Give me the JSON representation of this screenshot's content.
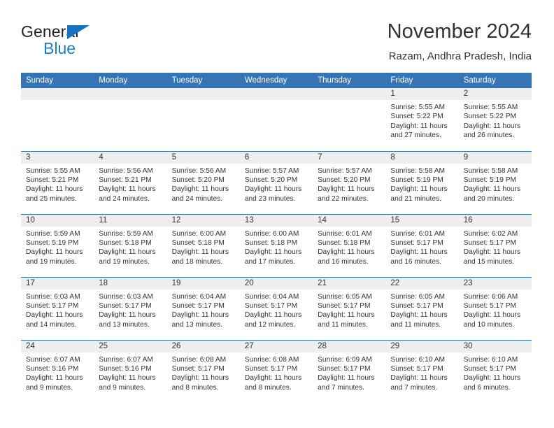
{
  "brand": {
    "word_one": "General",
    "word_two": "Blue",
    "triangle_icon": "blue-triangle-logo-mark",
    "accent_color": "#1a7ec6"
  },
  "header": {
    "title": "November 2024",
    "subtitle": "Razam, Andhra Pradesh, India"
  },
  "theme": {
    "header_blue": "#3575b5",
    "band_gray": "#eeeeee",
    "text": "#333333"
  },
  "weekdays": [
    "Sunday",
    "Monday",
    "Tuesday",
    "Wednesday",
    "Thursday",
    "Friday",
    "Saturday"
  ],
  "labels": {
    "sunrise": "Sunrise:",
    "sunset": "Sunset:",
    "daylight": "Daylight:"
  },
  "weeks": [
    [
      {
        "day": "",
        "sunrise": "",
        "sunset": "",
        "daylight_line1": "",
        "daylight_line2": ""
      },
      {
        "day": "",
        "sunrise": "",
        "sunset": "",
        "daylight_line1": "",
        "daylight_line2": ""
      },
      {
        "day": "",
        "sunrise": "",
        "sunset": "",
        "daylight_line1": "",
        "daylight_line2": ""
      },
      {
        "day": "",
        "sunrise": "",
        "sunset": "",
        "daylight_line1": "",
        "daylight_line2": ""
      },
      {
        "day": "",
        "sunrise": "",
        "sunset": "",
        "daylight_line1": "",
        "daylight_line2": ""
      },
      {
        "day": "1",
        "sunrise": "Sunrise: 5:55 AM",
        "sunset": "Sunset: 5:22 PM",
        "daylight_line1": "Daylight: 11 hours",
        "daylight_line2": "and 27 minutes."
      },
      {
        "day": "2",
        "sunrise": "Sunrise: 5:55 AM",
        "sunset": "Sunset: 5:22 PM",
        "daylight_line1": "Daylight: 11 hours",
        "daylight_line2": "and 26 minutes."
      }
    ],
    [
      {
        "day": "3",
        "sunrise": "Sunrise: 5:55 AM",
        "sunset": "Sunset: 5:21 PM",
        "daylight_line1": "Daylight: 11 hours",
        "daylight_line2": "and 25 minutes."
      },
      {
        "day": "4",
        "sunrise": "Sunrise: 5:56 AM",
        "sunset": "Sunset: 5:21 PM",
        "daylight_line1": "Daylight: 11 hours",
        "daylight_line2": "and 24 minutes."
      },
      {
        "day": "5",
        "sunrise": "Sunrise: 5:56 AM",
        "sunset": "Sunset: 5:20 PM",
        "daylight_line1": "Daylight: 11 hours",
        "daylight_line2": "and 24 minutes."
      },
      {
        "day": "6",
        "sunrise": "Sunrise: 5:57 AM",
        "sunset": "Sunset: 5:20 PM",
        "daylight_line1": "Daylight: 11 hours",
        "daylight_line2": "and 23 minutes."
      },
      {
        "day": "7",
        "sunrise": "Sunrise: 5:57 AM",
        "sunset": "Sunset: 5:20 PM",
        "daylight_line1": "Daylight: 11 hours",
        "daylight_line2": "and 22 minutes."
      },
      {
        "day": "8",
        "sunrise": "Sunrise: 5:58 AM",
        "sunset": "Sunset: 5:19 PM",
        "daylight_line1": "Daylight: 11 hours",
        "daylight_line2": "and 21 minutes."
      },
      {
        "day": "9",
        "sunrise": "Sunrise: 5:58 AM",
        "sunset": "Sunset: 5:19 PM",
        "daylight_line1": "Daylight: 11 hours",
        "daylight_line2": "and 20 minutes."
      }
    ],
    [
      {
        "day": "10",
        "sunrise": "Sunrise: 5:59 AM",
        "sunset": "Sunset: 5:19 PM",
        "daylight_line1": "Daylight: 11 hours",
        "daylight_line2": "and 19 minutes."
      },
      {
        "day": "11",
        "sunrise": "Sunrise: 5:59 AM",
        "sunset": "Sunset: 5:18 PM",
        "daylight_line1": "Daylight: 11 hours",
        "daylight_line2": "and 19 minutes."
      },
      {
        "day": "12",
        "sunrise": "Sunrise: 6:00 AM",
        "sunset": "Sunset: 5:18 PM",
        "daylight_line1": "Daylight: 11 hours",
        "daylight_line2": "and 18 minutes."
      },
      {
        "day": "13",
        "sunrise": "Sunrise: 6:00 AM",
        "sunset": "Sunset: 5:18 PM",
        "daylight_line1": "Daylight: 11 hours",
        "daylight_line2": "and 17 minutes."
      },
      {
        "day": "14",
        "sunrise": "Sunrise: 6:01 AM",
        "sunset": "Sunset: 5:18 PM",
        "daylight_line1": "Daylight: 11 hours",
        "daylight_line2": "and 16 minutes."
      },
      {
        "day": "15",
        "sunrise": "Sunrise: 6:01 AM",
        "sunset": "Sunset: 5:17 PM",
        "daylight_line1": "Daylight: 11 hours",
        "daylight_line2": "and 16 minutes."
      },
      {
        "day": "16",
        "sunrise": "Sunrise: 6:02 AM",
        "sunset": "Sunset: 5:17 PM",
        "daylight_line1": "Daylight: 11 hours",
        "daylight_line2": "and 15 minutes."
      }
    ],
    [
      {
        "day": "17",
        "sunrise": "Sunrise: 6:03 AM",
        "sunset": "Sunset: 5:17 PM",
        "daylight_line1": "Daylight: 11 hours",
        "daylight_line2": "and 14 minutes."
      },
      {
        "day": "18",
        "sunrise": "Sunrise: 6:03 AM",
        "sunset": "Sunset: 5:17 PM",
        "daylight_line1": "Daylight: 11 hours",
        "daylight_line2": "and 13 minutes."
      },
      {
        "day": "19",
        "sunrise": "Sunrise: 6:04 AM",
        "sunset": "Sunset: 5:17 PM",
        "daylight_line1": "Daylight: 11 hours",
        "daylight_line2": "and 13 minutes."
      },
      {
        "day": "20",
        "sunrise": "Sunrise: 6:04 AM",
        "sunset": "Sunset: 5:17 PM",
        "daylight_line1": "Daylight: 11 hours",
        "daylight_line2": "and 12 minutes."
      },
      {
        "day": "21",
        "sunrise": "Sunrise: 6:05 AM",
        "sunset": "Sunset: 5:17 PM",
        "daylight_line1": "Daylight: 11 hours",
        "daylight_line2": "and 11 minutes."
      },
      {
        "day": "22",
        "sunrise": "Sunrise: 6:05 AM",
        "sunset": "Sunset: 5:17 PM",
        "daylight_line1": "Daylight: 11 hours",
        "daylight_line2": "and 11 minutes."
      },
      {
        "day": "23",
        "sunrise": "Sunrise: 6:06 AM",
        "sunset": "Sunset: 5:17 PM",
        "daylight_line1": "Daylight: 11 hours",
        "daylight_line2": "and 10 minutes."
      }
    ],
    [
      {
        "day": "24",
        "sunrise": "Sunrise: 6:07 AM",
        "sunset": "Sunset: 5:16 PM",
        "daylight_line1": "Daylight: 11 hours",
        "daylight_line2": "and 9 minutes."
      },
      {
        "day": "25",
        "sunrise": "Sunrise: 6:07 AM",
        "sunset": "Sunset: 5:16 PM",
        "daylight_line1": "Daylight: 11 hours",
        "daylight_line2": "and 9 minutes."
      },
      {
        "day": "26",
        "sunrise": "Sunrise: 6:08 AM",
        "sunset": "Sunset: 5:17 PM",
        "daylight_line1": "Daylight: 11 hours",
        "daylight_line2": "and 8 minutes."
      },
      {
        "day": "27",
        "sunrise": "Sunrise: 6:08 AM",
        "sunset": "Sunset: 5:17 PM",
        "daylight_line1": "Daylight: 11 hours",
        "daylight_line2": "and 8 minutes."
      },
      {
        "day": "28",
        "sunrise": "Sunrise: 6:09 AM",
        "sunset": "Sunset: 5:17 PM",
        "daylight_line1": "Daylight: 11 hours",
        "daylight_line2": "and 7 minutes."
      },
      {
        "day": "29",
        "sunrise": "Sunrise: 6:10 AM",
        "sunset": "Sunset: 5:17 PM",
        "daylight_line1": "Daylight: 11 hours",
        "daylight_line2": "and 7 minutes."
      },
      {
        "day": "30",
        "sunrise": "Sunrise: 6:10 AM",
        "sunset": "Sunset: 5:17 PM",
        "daylight_line1": "Daylight: 11 hours",
        "daylight_line2": "and 6 minutes."
      }
    ]
  ]
}
